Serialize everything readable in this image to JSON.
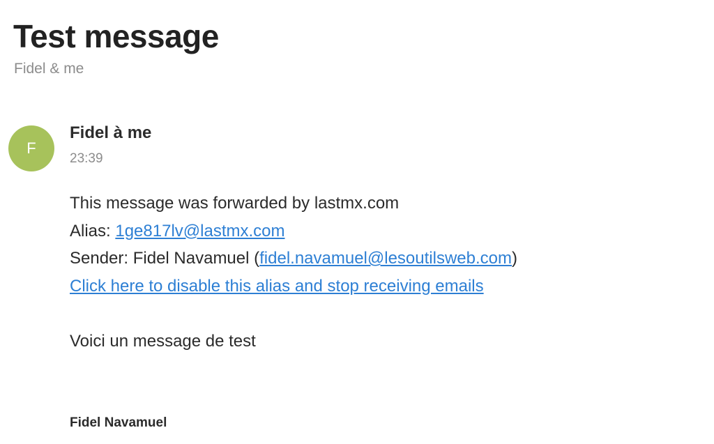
{
  "message": {
    "subject": "Test message",
    "participants": "Fidel & me",
    "avatar_initial": "F",
    "avatar_color": "#a7c25b",
    "from_line": "Fidel à me",
    "time": "23:39"
  },
  "body": {
    "forward_notice": "This message was forwarded by lastmx.com",
    "alias_prefix": "Alias: ",
    "alias_email": "1ge817lv@lastmx.com",
    "sender_prefix": "Sender: Fidel Navamuel (",
    "sender_email": "fidel.navamuel@lesoutilsweb.com",
    "sender_suffix": ")",
    "disable_link": "Click here to disable this alias and stop receiving emails",
    "content": "Voici un message de test",
    "signature_name": "Fidel Navamuel"
  },
  "colors": {
    "link": "#2d7fd4",
    "muted_text": "#8c8c8c"
  }
}
